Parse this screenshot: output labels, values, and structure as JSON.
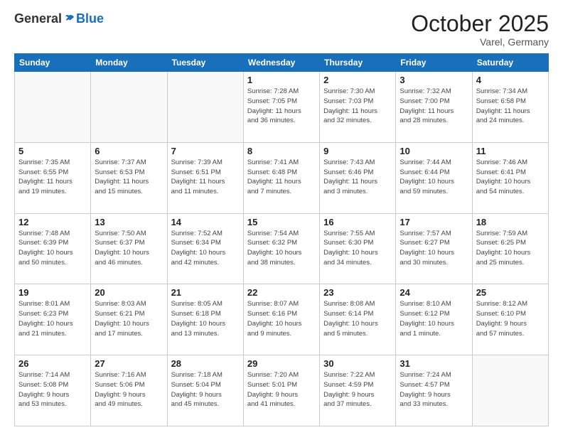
{
  "header": {
    "logo_general": "General",
    "logo_blue": "Blue",
    "month": "October 2025",
    "location": "Varel, Germany"
  },
  "weekdays": [
    "Sunday",
    "Monday",
    "Tuesday",
    "Wednesday",
    "Thursday",
    "Friday",
    "Saturday"
  ],
  "weeks": [
    [
      {
        "day": "",
        "info": ""
      },
      {
        "day": "",
        "info": ""
      },
      {
        "day": "",
        "info": ""
      },
      {
        "day": "1",
        "info": "Sunrise: 7:28 AM\nSunset: 7:05 PM\nDaylight: 11 hours\nand 36 minutes."
      },
      {
        "day": "2",
        "info": "Sunrise: 7:30 AM\nSunset: 7:03 PM\nDaylight: 11 hours\nand 32 minutes."
      },
      {
        "day": "3",
        "info": "Sunrise: 7:32 AM\nSunset: 7:00 PM\nDaylight: 11 hours\nand 28 minutes."
      },
      {
        "day": "4",
        "info": "Sunrise: 7:34 AM\nSunset: 6:58 PM\nDaylight: 11 hours\nand 24 minutes."
      }
    ],
    [
      {
        "day": "5",
        "info": "Sunrise: 7:35 AM\nSunset: 6:55 PM\nDaylight: 11 hours\nand 19 minutes."
      },
      {
        "day": "6",
        "info": "Sunrise: 7:37 AM\nSunset: 6:53 PM\nDaylight: 11 hours\nand 15 minutes."
      },
      {
        "day": "7",
        "info": "Sunrise: 7:39 AM\nSunset: 6:51 PM\nDaylight: 11 hours\nand 11 minutes."
      },
      {
        "day": "8",
        "info": "Sunrise: 7:41 AM\nSunset: 6:48 PM\nDaylight: 11 hours\nand 7 minutes."
      },
      {
        "day": "9",
        "info": "Sunrise: 7:43 AM\nSunset: 6:46 PM\nDaylight: 11 hours\nand 3 minutes."
      },
      {
        "day": "10",
        "info": "Sunrise: 7:44 AM\nSunset: 6:44 PM\nDaylight: 10 hours\nand 59 minutes."
      },
      {
        "day": "11",
        "info": "Sunrise: 7:46 AM\nSunset: 6:41 PM\nDaylight: 10 hours\nand 54 minutes."
      }
    ],
    [
      {
        "day": "12",
        "info": "Sunrise: 7:48 AM\nSunset: 6:39 PM\nDaylight: 10 hours\nand 50 minutes."
      },
      {
        "day": "13",
        "info": "Sunrise: 7:50 AM\nSunset: 6:37 PM\nDaylight: 10 hours\nand 46 minutes."
      },
      {
        "day": "14",
        "info": "Sunrise: 7:52 AM\nSunset: 6:34 PM\nDaylight: 10 hours\nand 42 minutes."
      },
      {
        "day": "15",
        "info": "Sunrise: 7:54 AM\nSunset: 6:32 PM\nDaylight: 10 hours\nand 38 minutes."
      },
      {
        "day": "16",
        "info": "Sunrise: 7:55 AM\nSunset: 6:30 PM\nDaylight: 10 hours\nand 34 minutes."
      },
      {
        "day": "17",
        "info": "Sunrise: 7:57 AM\nSunset: 6:27 PM\nDaylight: 10 hours\nand 30 minutes."
      },
      {
        "day": "18",
        "info": "Sunrise: 7:59 AM\nSunset: 6:25 PM\nDaylight: 10 hours\nand 25 minutes."
      }
    ],
    [
      {
        "day": "19",
        "info": "Sunrise: 8:01 AM\nSunset: 6:23 PM\nDaylight: 10 hours\nand 21 minutes."
      },
      {
        "day": "20",
        "info": "Sunrise: 8:03 AM\nSunset: 6:21 PM\nDaylight: 10 hours\nand 17 minutes."
      },
      {
        "day": "21",
        "info": "Sunrise: 8:05 AM\nSunset: 6:18 PM\nDaylight: 10 hours\nand 13 minutes."
      },
      {
        "day": "22",
        "info": "Sunrise: 8:07 AM\nSunset: 6:16 PM\nDaylight: 10 hours\nand 9 minutes."
      },
      {
        "day": "23",
        "info": "Sunrise: 8:08 AM\nSunset: 6:14 PM\nDaylight: 10 hours\nand 5 minutes."
      },
      {
        "day": "24",
        "info": "Sunrise: 8:10 AM\nSunset: 6:12 PM\nDaylight: 10 hours\nand 1 minute."
      },
      {
        "day": "25",
        "info": "Sunrise: 8:12 AM\nSunset: 6:10 PM\nDaylight: 9 hours\nand 57 minutes."
      }
    ],
    [
      {
        "day": "26",
        "info": "Sunrise: 7:14 AM\nSunset: 5:08 PM\nDaylight: 9 hours\nand 53 minutes."
      },
      {
        "day": "27",
        "info": "Sunrise: 7:16 AM\nSunset: 5:06 PM\nDaylight: 9 hours\nand 49 minutes."
      },
      {
        "day": "28",
        "info": "Sunrise: 7:18 AM\nSunset: 5:04 PM\nDaylight: 9 hours\nand 45 minutes."
      },
      {
        "day": "29",
        "info": "Sunrise: 7:20 AM\nSunset: 5:01 PM\nDaylight: 9 hours\nand 41 minutes."
      },
      {
        "day": "30",
        "info": "Sunrise: 7:22 AM\nSunset: 4:59 PM\nDaylight: 9 hours\nand 37 minutes."
      },
      {
        "day": "31",
        "info": "Sunrise: 7:24 AM\nSunset: 4:57 PM\nDaylight: 9 hours\nand 33 minutes."
      },
      {
        "day": "",
        "info": ""
      }
    ]
  ]
}
